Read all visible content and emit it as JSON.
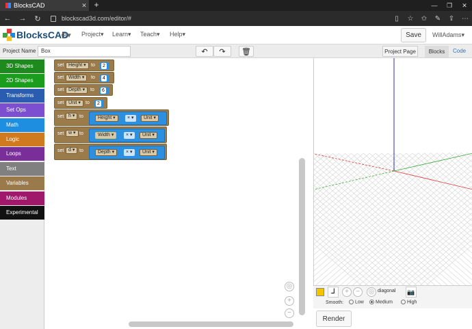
{
  "browser": {
    "tab_title": "BlocksCAD",
    "tab_close": "✕",
    "new_tab": "+",
    "url": "blockscad3d.com/editor/#",
    "window_controls": [
      "—",
      "❐",
      "✕"
    ]
  },
  "header": {
    "logo_text": "BlocksCAD",
    "menus": [
      "Project",
      "Learn",
      "Teach",
      "Help"
    ],
    "save_label": "Save",
    "user": "WillAdams"
  },
  "toolbar": {
    "project_name_label": "Project Name",
    "project_name_value": "Box",
    "project_page_label": "Project Page",
    "blocks_tab": "Blocks",
    "code_tab": "Code"
  },
  "categories": [
    {
      "label": "3D Shapes",
      "color": "#1e8a1e"
    },
    {
      "label": "2D Shapes",
      "color": "#1c9c1c"
    },
    {
      "label": "Transforms",
      "color": "#2a5db0"
    },
    {
      "label": "Set Ops",
      "color": "#7b4fd0"
    },
    {
      "label": "Math",
      "color": "#1e8fe0"
    },
    {
      "label": "Logic",
      "color": "#d07a20"
    },
    {
      "label": "Loops",
      "color": "#7a2e9a"
    },
    {
      "label": "Text",
      "color": "#808080"
    },
    {
      "label": "Variables",
      "color": "#9a7a4a"
    },
    {
      "label": "Modules",
      "color": "#a0186a"
    },
    {
      "label": "Experimental",
      "color": "#111111"
    }
  ],
  "blocks": {
    "set": "set",
    "to": "to",
    "times": "×",
    "rows": [
      {
        "var": "Height",
        "value": "2"
      },
      {
        "var": "Width",
        "value": "4"
      },
      {
        "var": "Depth",
        "value": "6"
      },
      {
        "var": "Unit",
        "value": "2"
      }
    ],
    "expr_rows": [
      {
        "var": "h",
        "left": "Height",
        "right": "Unit"
      },
      {
        "var": "w",
        "left": "Width",
        "right": "Unit"
      },
      {
        "var": "d",
        "left": "Depth",
        "right": "Unit"
      }
    ]
  },
  "view": {
    "camera": "diagonal",
    "smooth_label": "Smooth:",
    "smooth_options": [
      "Low",
      "Medium",
      "High"
    ],
    "smooth_selected": "Medium",
    "render_label": "Render",
    "color_swatch": "#f5c400"
  }
}
